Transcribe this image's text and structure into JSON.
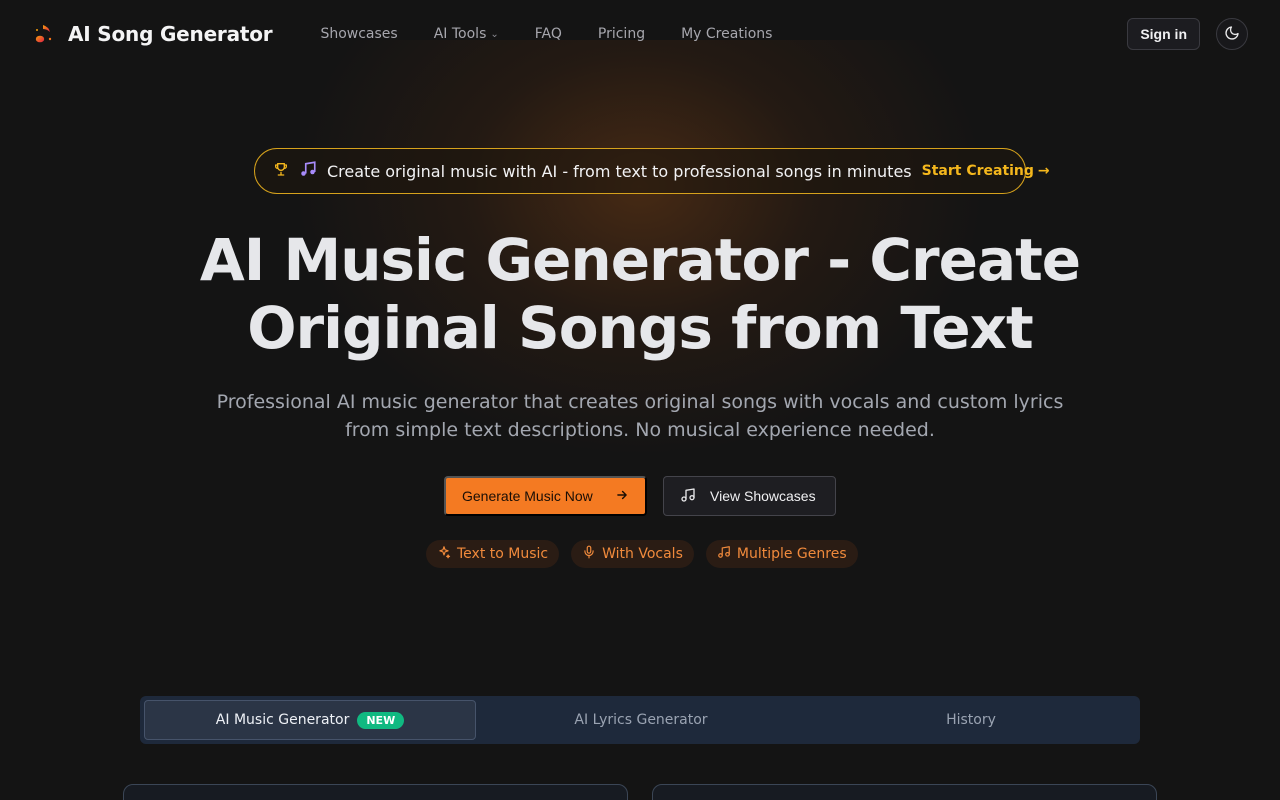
{
  "header": {
    "brand_title": "AI Song Generator",
    "nav": [
      {
        "label": "Showcases"
      },
      {
        "label": "AI Tools",
        "has_dropdown": true
      },
      {
        "label": "FAQ"
      },
      {
        "label": "Pricing"
      },
      {
        "label": "My Creations"
      }
    ],
    "signin_label": "Sign in",
    "theme_icon": "moon-icon"
  },
  "announcement": {
    "text": "Create original music with AI - from text to professional songs in minutes",
    "link_label": "Start Creating",
    "icons": [
      "trophy-icon",
      "music-note-icon",
      "arrow-right-icon"
    ]
  },
  "hero": {
    "title_line1": "AI Music Generator - Create",
    "title_line2": "Original Songs from Text",
    "subtitle_line1": "Professional AI music generator that creates original songs with vocals and custom lyrics",
    "subtitle_line2": "from simple text descriptions. No musical experience needed.",
    "primary_cta": "Generate Music Now",
    "secondary_cta": "View Showcases"
  },
  "features": [
    {
      "label": "Text to Music",
      "icon": "sparkles-icon"
    },
    {
      "label": "With Vocals",
      "icon": "microphone-icon"
    },
    {
      "label": "Multiple Genres",
      "icon": "music-note-icon"
    }
  ],
  "tabs": [
    {
      "label": "AI Music Generator",
      "badge": "NEW",
      "active": true
    },
    {
      "label": "AI Lyrics Generator",
      "active": false
    },
    {
      "label": "History",
      "active": false
    }
  ],
  "colors": {
    "accent": "#f47a22",
    "gold": "#f4b71d",
    "badge_green": "#10b981",
    "background": "#141414",
    "tab_bar": "#1e293b"
  }
}
